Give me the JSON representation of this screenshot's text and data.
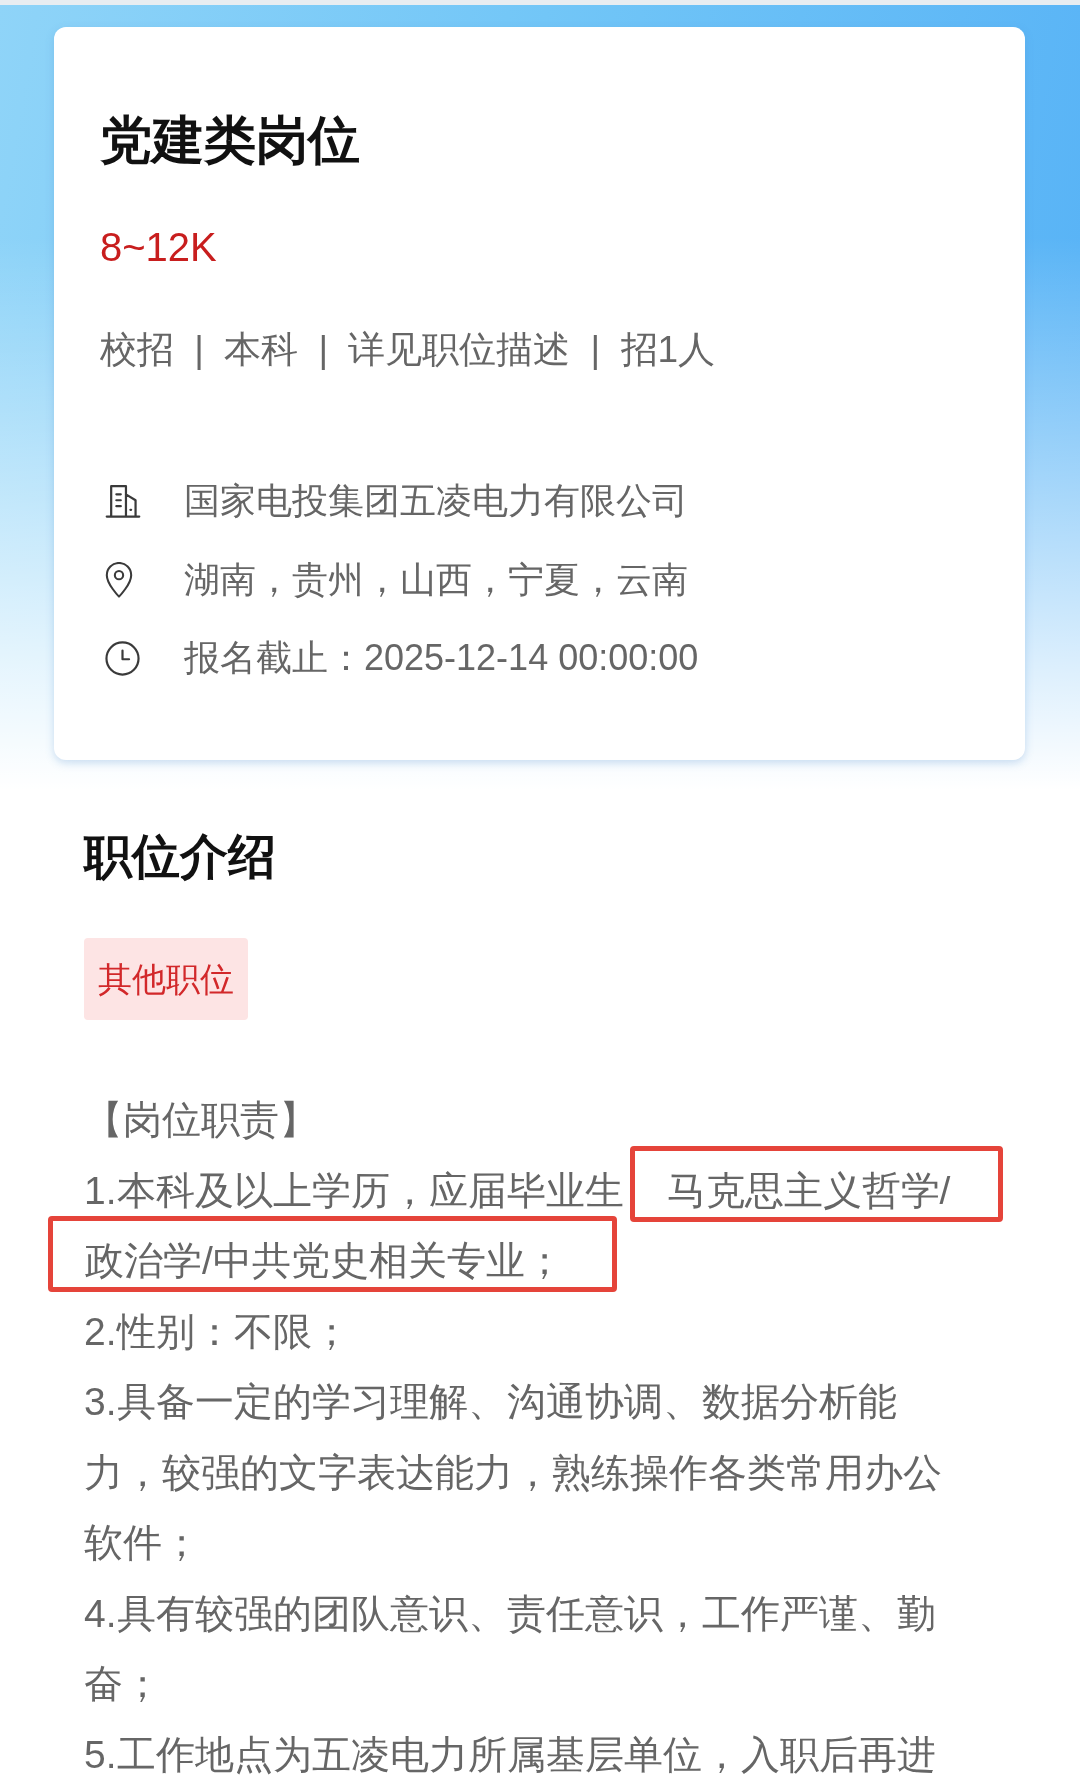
{
  "job": {
    "title": "党建类岗位",
    "salary": "8~12K",
    "summary": "校招 | 本科 | 详见职位描述 | 招1人",
    "details": [
      {
        "kind": "company",
        "text": "国家电投集团五凌电力有限公司"
      },
      {
        "kind": "location",
        "text": "湖南，贵州，山西，宁夏，云南"
      },
      {
        "kind": "deadline",
        "text": "报名截止：2025-12-14 00:00:00"
      }
    ]
  },
  "section_title": "职位介绍",
  "category_tag": "其他职位",
  "description": [
    {
      "kind": "heading",
      "text": "【岗位职责】"
    },
    {
      "kind": "marked",
      "parts": [
        {
          "text": "1.本科及以上学历，应届毕业生",
          "marked": false
        },
        {
          "text": "马克思主义哲学/",
          "marked": true
        },
        {
          "text": "政治学/中共党史相关专业；",
          "marked": true
        }
      ]
    },
    {
      "kind": "text",
      "text": "2.性别：不限；"
    },
    {
      "kind": "text",
      "text": "3.具备一定的学习理解、沟通协调、数据分析能力，较强的文字表达能力，熟练操作各类常用办公软件；"
    },
    {
      "kind": "text",
      "text": "4.具有较强的团队意识、责任意识，工作严谨、勤奋；"
    },
    {
      "kind": "text",
      "text": "5.工作地点为五凌电力所属基层单位，入职后再进"
    }
  ]
}
